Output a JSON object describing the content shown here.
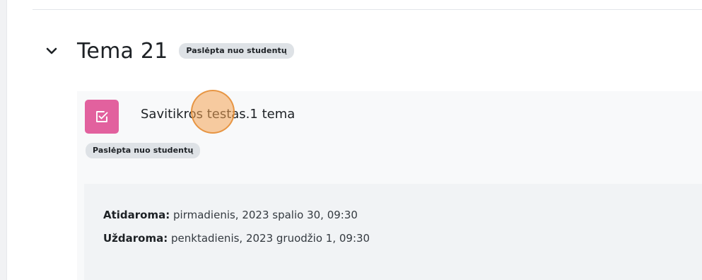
{
  "section": {
    "title": "Tema 21",
    "visibility_badge": "Paslėpta nuo studentų",
    "collapse_icon": "chevron-down-icon"
  },
  "activity": {
    "icon": "quiz-checkbox-icon",
    "icon_color": "#e2619e",
    "name": "Savitikros testas.1 tema",
    "visibility_badge": "Paslėpta nuo studentų",
    "dates": {
      "open_label": "Atidaroma:",
      "open_value": " pirmadienis, 2023 spalio 30, 09:30",
      "close_label": "Uždaroma:",
      "close_value": " penktadienis, 2023 gruodžio 1, 09:30"
    }
  },
  "cursor_highlight_color": "#f4a454"
}
